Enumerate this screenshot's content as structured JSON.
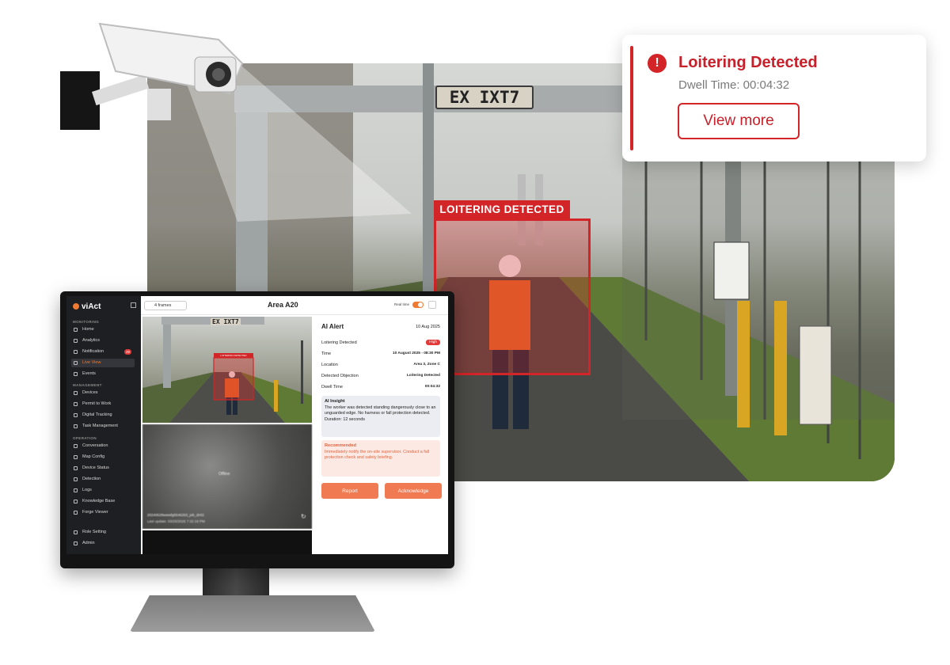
{
  "scene": {
    "sign_text": "EX IXT7",
    "detection_label": "LOITERING DETECTED"
  },
  "alert_card": {
    "title": "Loitering Detected",
    "dwell": "Dwell Time: 00:04:32",
    "view_more": "View more",
    "accent": "#d32427"
  },
  "app": {
    "brand": "viAct",
    "sections": {
      "monitoring": "MONITORING",
      "management": "MANAGEMENT",
      "operation": "OPERATION"
    },
    "nav": [
      {
        "label": "Home",
        "icon": "home-icon"
      },
      {
        "label": "Analytics",
        "icon": "analytics-icon"
      },
      {
        "label": "Notification",
        "icon": "bell-icon",
        "badge": "29"
      },
      {
        "label": "Live View",
        "icon": "live-view-icon",
        "active": true
      },
      {
        "label": "Events",
        "icon": "events-icon"
      },
      {
        "label": "Devices",
        "icon": "devices-icon"
      },
      {
        "label": "Permit to Work",
        "icon": "permit-icon"
      },
      {
        "label": "Digital Tracking",
        "icon": "tracking-icon"
      },
      {
        "label": "Task Management",
        "icon": "task-icon"
      },
      {
        "label": "Conversation",
        "icon": "chat-icon"
      },
      {
        "label": "Map Config",
        "icon": "map-icon"
      },
      {
        "label": "Device Status",
        "icon": "status-icon"
      },
      {
        "label": "Detection",
        "icon": "detection-icon"
      },
      {
        "label": "Logs",
        "icon": "logs-icon"
      },
      {
        "label": "Knowledge Base",
        "icon": "knowledge-icon"
      },
      {
        "label": "Forge Viewer",
        "icon": "viewer-icon"
      },
      {
        "label": "Role Setting",
        "icon": "role-icon"
      },
      {
        "label": "Admin",
        "icon": "admin-icon"
      }
    ],
    "topbar": {
      "frames": "4 frames",
      "area": "Area A20",
      "realtime": "Real time"
    },
    "feed1": {
      "sign_text": "EX IXT7",
      "label": "LOITERING DETECTED"
    },
    "feed2": {
      "status": "Offline",
      "camera_id": "20240628wwwfg5546263_job_dz02",
      "last_update": "Last update: 03/25/2025 7:32:18 PM"
    },
    "panel": {
      "title": "AI Alert",
      "date": "10 Aug 2025",
      "rows": [
        {
          "k": "Loitering Detected",
          "v": "High"
        },
        {
          "k": "Time",
          "v": "10 August 2025 - 08:30 PM"
        },
        {
          "k": "Location",
          "v": "Area 3, Zone C"
        },
        {
          "k": "Detected Objection",
          "v": "Loitering Detected"
        },
        {
          "k": "Dwell Time",
          "v": "00:04:32"
        }
      ],
      "insight_title": "AI Insight",
      "insight_text": "The worker was detected standing dangerously close to an unguarded edge. No harness or fall protection detected. Duration: 12 seconds",
      "rec_title": "Recommended",
      "rec_text": "Immediately notify the on-site supervisor. Conduct a fall protection check and safety briefing.",
      "report": "Report",
      "acknowledge": "Acknowledge"
    }
  }
}
